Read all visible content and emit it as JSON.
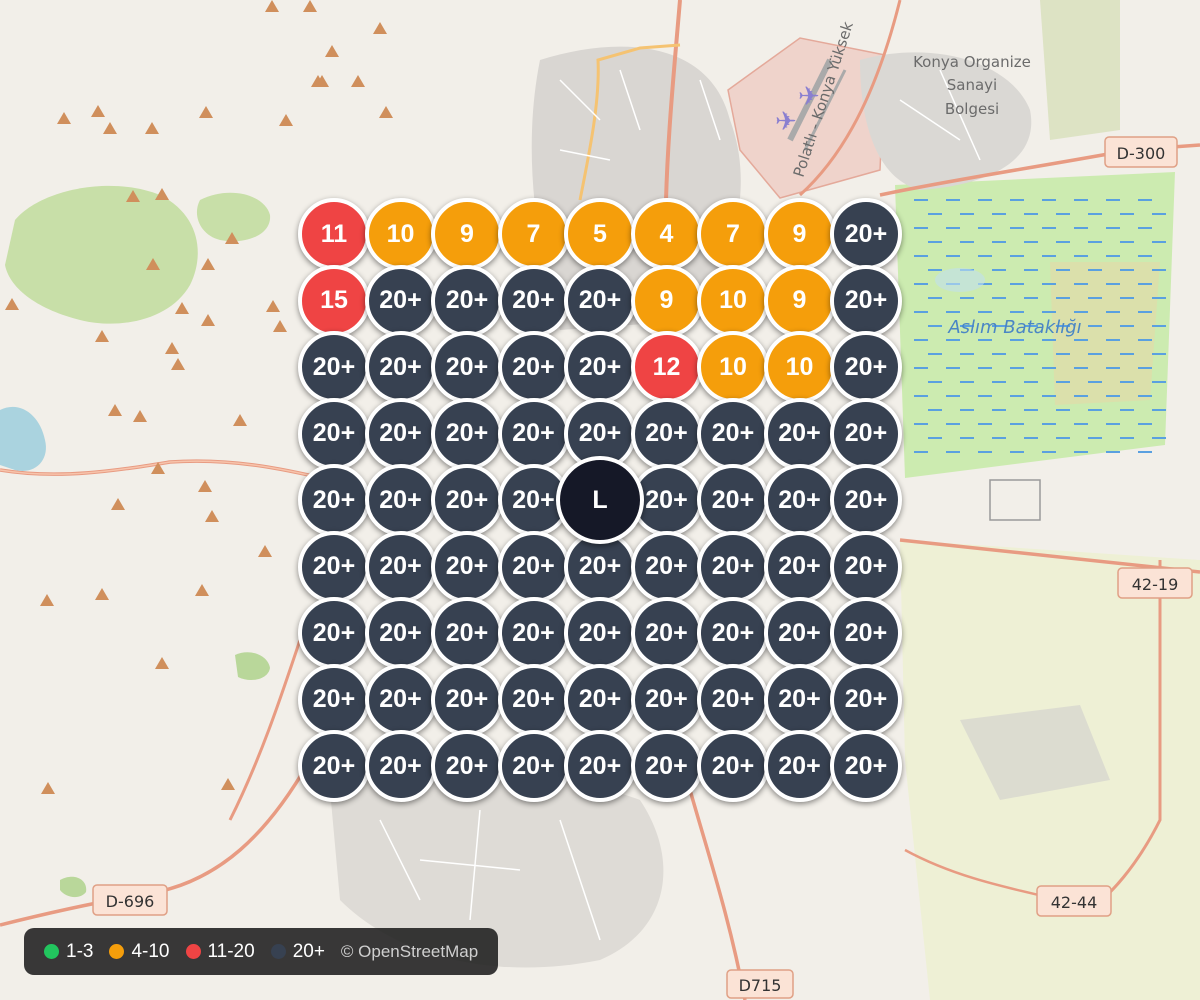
{
  "map": {
    "place_labels": [
      "Konya Organize",
      "Sanayi",
      "Bolgesi"
    ],
    "water_label": "Aslım Bataklığı",
    "road_shields": [
      "D-300",
      "42-19",
      "D-696",
      "42-44",
      "D715"
    ],
    "diagonal_road_label": "Polatlı - Konya Yüksek"
  },
  "grid": {
    "center_label": "L",
    "rows": [
      [
        "11",
        "10",
        "9",
        "7",
        "5",
        "4",
        "7",
        "9",
        "20+"
      ],
      [
        "15",
        "20+",
        "20+",
        "20+",
        "20+",
        "9",
        "10",
        "9",
        "20+"
      ],
      [
        "20+",
        "20+",
        "20+",
        "20+",
        "20+",
        "12",
        "10",
        "10",
        "20+"
      ],
      [
        "20+",
        "20+",
        "20+",
        "20+",
        "20+",
        "20+",
        "20+",
        "20+",
        "20+"
      ],
      [
        "20+",
        "20+",
        "20+",
        "20+",
        "20+",
        "20+",
        "20+",
        "20+",
        "20+"
      ],
      [
        "20+",
        "20+",
        "20+",
        "20+",
        "20+",
        "20+",
        "20+",
        "20+",
        "20+"
      ],
      [
        "20+",
        "20+",
        "20+",
        "20+",
        "20+",
        "20+",
        "20+",
        "20+",
        "20+"
      ],
      [
        "20+",
        "20+",
        "20+",
        "20+",
        "20+",
        "20+",
        "20+",
        "20+",
        "20+"
      ],
      [
        "20+",
        "20+",
        "20+",
        "20+",
        "20+",
        "20+",
        "20+",
        "20+",
        "20+"
      ]
    ],
    "colors": {
      "low": "#22c55e",
      "mid": "#f59e0b",
      "high": "#ef4444",
      "max": "#374151",
      "center": "#151827"
    }
  },
  "legend": {
    "items": [
      {
        "label": "1-3",
        "color": "#22c55e"
      },
      {
        "label": "4-10",
        "color": "#f59e0b"
      },
      {
        "label": "11-20",
        "color": "#ef4444"
      },
      {
        "label": "20+",
        "color": "#374151"
      }
    ],
    "attribution": "© OpenStreetMap"
  }
}
